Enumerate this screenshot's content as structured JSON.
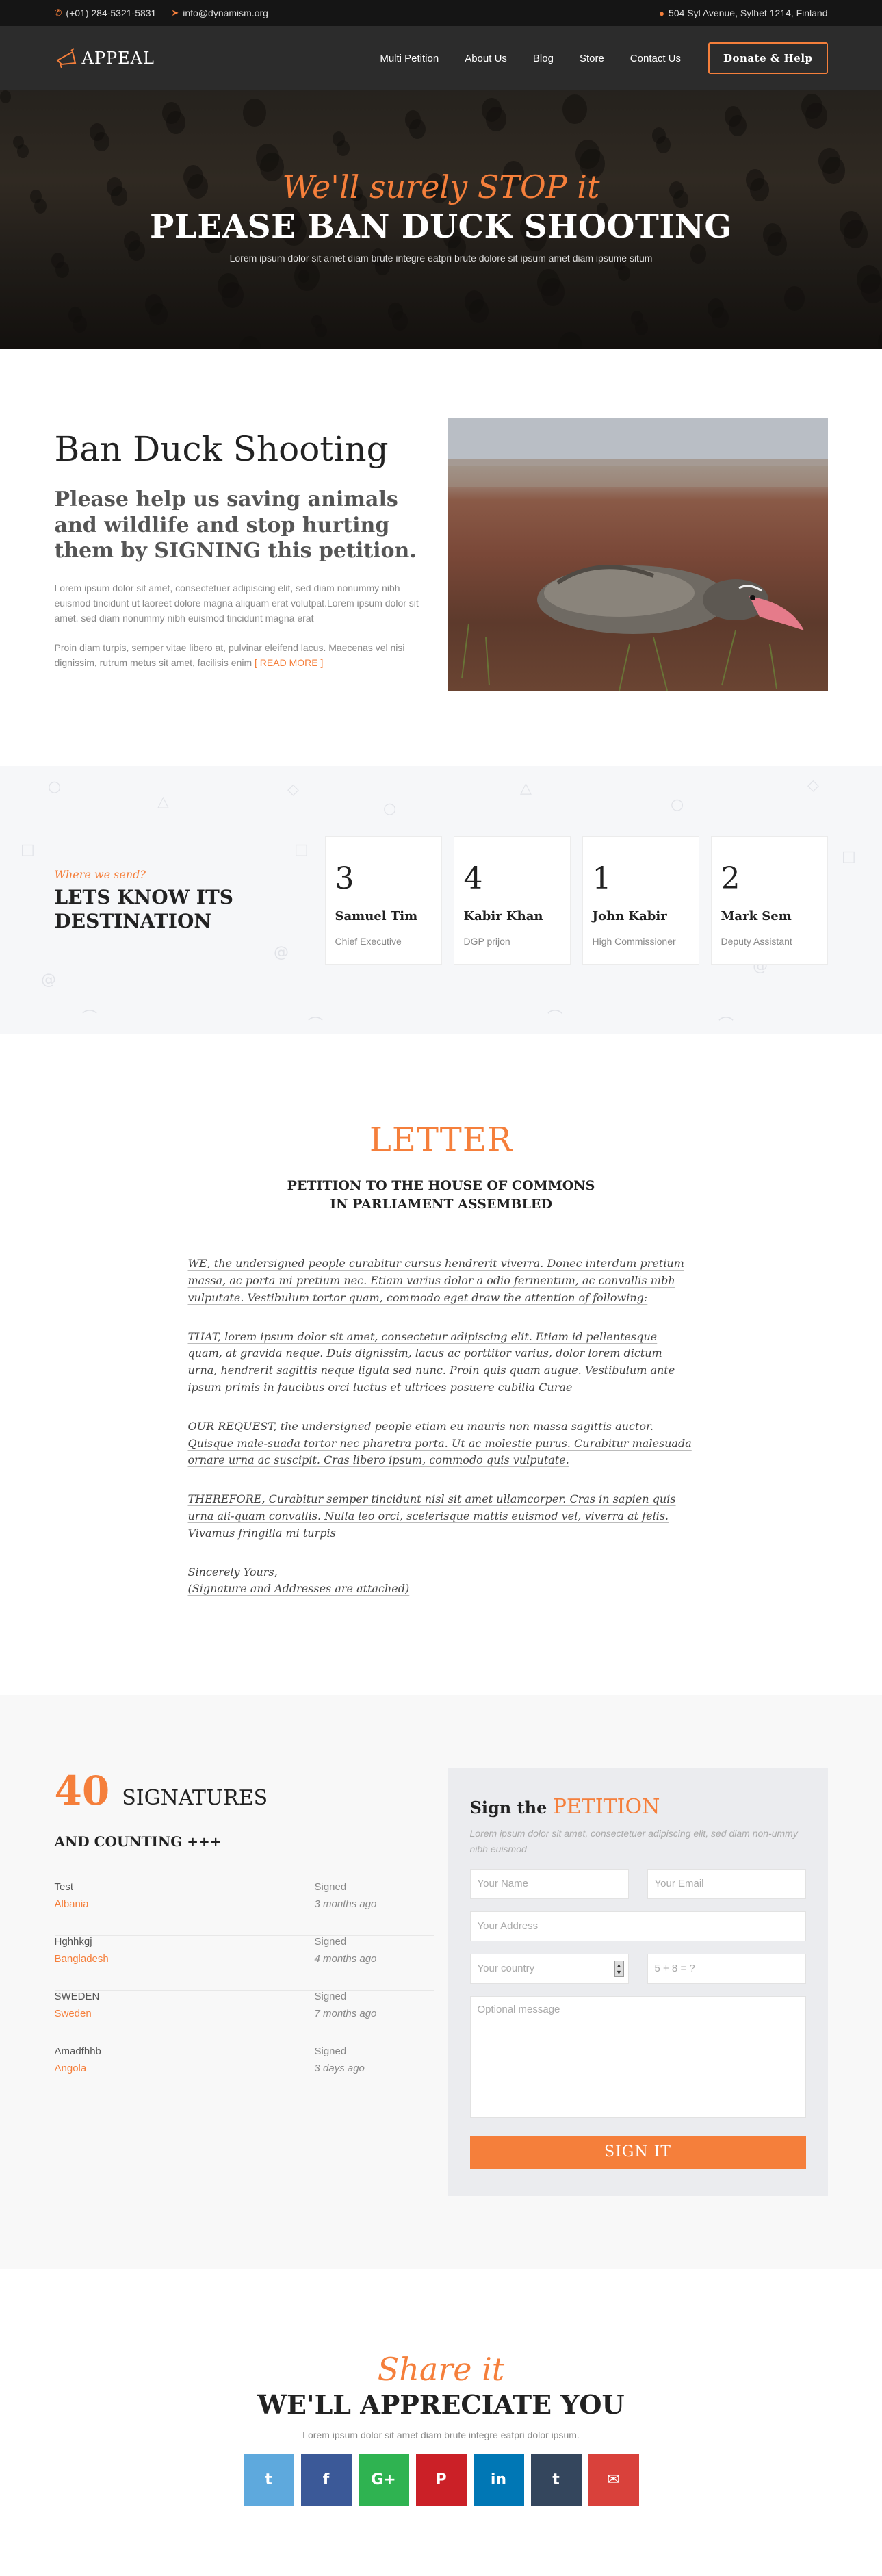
{
  "topbar": {
    "phone": "(+01) 284-5321-5831",
    "email": "info@dynamism.org",
    "address": "504 Syl Avenue, Sylhet 1214, Finland"
  },
  "header": {
    "logo": "APPEAL",
    "nav": [
      "Multi Petition",
      "About Us",
      "Blog",
      "Store",
      "Contact Us"
    ],
    "donate": "Donate & Help"
  },
  "hero": {
    "script": "We'll surely STOP it",
    "title": "PLEASE BAN DUCK SHOOTING",
    "subtitle": "Lorem ipsum dolor sit amet diam brute integre eatpri brute dolore sit ipsum amet diam ipsume situm"
  },
  "intro": {
    "title": "Ban Duck Shooting",
    "lead": "Please help us saving animals and wildlife and stop hurting them by SIGNING this petition.",
    "p1": "Lorem ipsum dolor sit amet, consectetuer adipiscing elit, sed diam nonummy nibh euismod tincidunt ut laoreet dolore magna aliquam erat volutpat.Lorem ipsum dolor sit amet. sed diam nonummy nibh euismod tincidunt magna erat",
    "p2": "Proin diam turpis, semper vitae libero at, pulvinar eleifend lacus. Maecenas vel nisi dignissim, rutrum metus sit amet, facilisis enim",
    "readmore": "[ READ MORE ]"
  },
  "destination": {
    "where": "Where we send?",
    "title_line1": "LETS KNOW ITS",
    "title_line2": "DESTINATION",
    "cards": [
      {
        "num": "3",
        "name": "Samuel Tim",
        "role": "Chief Executive"
      },
      {
        "num": "4",
        "name": "Kabir Khan",
        "role": "DGP prijon"
      },
      {
        "num": "1",
        "name": "John Kabir",
        "role": "High Commissioner"
      },
      {
        "num": "2",
        "name": "Mark Sem",
        "role": "Deputy Assistant"
      }
    ]
  },
  "letter": {
    "title": "LETTER",
    "sub1": "PETITION TO THE HOUSE OF COMMONS",
    "sub2": "IN PARLIAMENT ASSEMBLED",
    "paragraphs": [
      "WE, the undersigned people curabitur cursus hendrerit viverra. Donec interdum pretium massa, ac porta mi pretium nec. Etiam varius dolor a odio fermentum, ac convallis nibh vulputate. Vestibulum tortor quam, commodo eget draw the attention of following:",
      "THAT, lorem ipsum dolor sit amet, consectetur adipiscing elit. Etiam id pellentesque quam, at gravida neque. Duis dignissim, lacus ac porttitor varius, dolor lorem dictum urna, hendrerit sagittis neque ligula sed nunc. Proin quis quam augue. Vestibulum ante ipsum primis in faucibus orci luctus et ultrices posuere cubilia Curae",
      "OUR REQUEST, the undersigned people etiam eu mauris non massa sagittis auctor. Quisque male-suada tortor nec pharetra porta. Ut ac molestie purus. Curabitur malesuada ornare urna ac suscipit. Cras libero ipsum, commodo quis vulputate.",
      "THEREFORE, Curabitur semper tincidunt nisl sit amet ullamcorper. Cras in sapien quis urna ali-quam convallis. Nulla leo orci, scelerisque mattis euismod vel, viverra at felis. Vivamus fringilla mi turpis"
    ],
    "closing1": "Sincerely Yours,",
    "closing2": "(Signature and Addresses are attached)"
  },
  "signatures": {
    "count": "40",
    "label": "SIGNATURES",
    "counting": "AND COUNTING +++",
    "list": [
      {
        "name": "Test",
        "country": "Albania",
        "status": "Signed",
        "ago": "3 months ago"
      },
      {
        "name": "Hghhkgj",
        "country": "Bangladesh",
        "status": "Signed",
        "ago": "4 months ago"
      },
      {
        "name": "SWEDEN",
        "country": "Sweden",
        "status": "Signed",
        "ago": "7 months ago"
      },
      {
        "name": "Amadfhhb",
        "country": "Angola",
        "status": "Signed",
        "ago": "3 days ago"
      }
    ]
  },
  "form": {
    "title_plain": "Sign the",
    "title_accent": "PETITION",
    "desc": "Lorem ipsum dolor sit amet, consectetuer adipiscing elit, sed diam non-ummy nibh euismod",
    "name_ph": "Your Name",
    "email_ph": "Your Email",
    "address_ph": "Your Address",
    "country_ph": "Your country",
    "captcha_ph": "5 + 8 = ?",
    "message_ph": "Optional message",
    "submit": "SIGN IT"
  },
  "share": {
    "script": "Share it",
    "title": "WE'LL APPRECIATE YOU",
    "subtitle": "Lorem ipsum dolor sit amet diam brute integre eatpri dolor ipsum.",
    "buttons": [
      {
        "icon": "twitter-icon",
        "glyph": "t",
        "color": "#5ea9dd"
      },
      {
        "icon": "facebook-icon",
        "glyph": "f",
        "color": "#3b5998"
      },
      {
        "icon": "google-plus-icon",
        "glyph": "G+",
        "color": "#2fb351"
      },
      {
        "icon": "pinterest-icon",
        "glyph": "P",
        "color": "#cb2027"
      },
      {
        "icon": "linkedin-icon",
        "glyph": "in",
        "color": "#0077b5"
      },
      {
        "icon": "tumblr-icon",
        "glyph": "t",
        "color": "#34465d"
      },
      {
        "icon": "email-icon",
        "glyph": "✉",
        "color": "#d9413b"
      }
    ]
  },
  "colors": {
    "accent": "#f57f3b",
    "dark": "#2c2c2c"
  }
}
